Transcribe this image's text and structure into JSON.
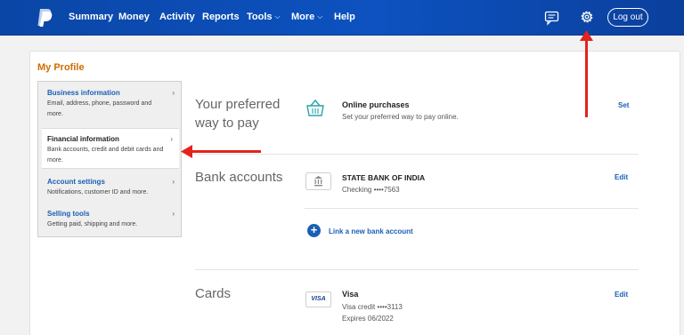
{
  "nav": {
    "logo": "paypal-logo-icon",
    "items": [
      {
        "label": "Summary"
      },
      {
        "label": "Money"
      },
      {
        "label": "Activity"
      },
      {
        "label": "Reports"
      },
      {
        "label": "Tools",
        "chevron": "⌵"
      },
      {
        "label": "More",
        "chevron": "⌵"
      },
      {
        "label": "Help"
      }
    ],
    "logout_label": "Log out",
    "icons": [
      "messages-icon",
      "gear-icon"
    ]
  },
  "profile": {
    "title": "My Profile",
    "menu": [
      {
        "label": "Business information",
        "desc_lines": [
          "Email, address, phone, password and",
          "more."
        ]
      },
      {
        "label": "Financial information",
        "desc_lines": [
          "Bank accounts, credit and debit cards and",
          "more."
        ]
      },
      {
        "label": "Account settings",
        "desc_lines": [
          "Notifications, customer ID and more."
        ]
      },
      {
        "label": "Selling tools",
        "desc_lines": [
          "Getting paid, shipping and more."
        ]
      }
    ],
    "active_menu_index": 1
  },
  "preferred": {
    "heading_lines": [
      "Your preferred",
      "way to pay"
    ],
    "title": "Online purchases",
    "subtitle": "Set your preferred way to pay online.",
    "action": "Set"
  },
  "bank": {
    "heading": "Bank accounts",
    "name": "STATE BANK OF INDIA",
    "detail": "Checking ••••7563",
    "action": "Edit",
    "link_label": "Link a new bank account"
  },
  "cards": {
    "heading": "Cards",
    "card_badge": "VISA",
    "name": "Visa",
    "detail": "Visa credit ••••3113",
    "expiry": "Expires 06/2022",
    "action": "Edit"
  },
  "colors": {
    "nav_bg": "#0d52c0",
    "accent_orange": "#d06c00",
    "link_blue": "#1a5fb4",
    "annotation_red": "#e3231c"
  }
}
